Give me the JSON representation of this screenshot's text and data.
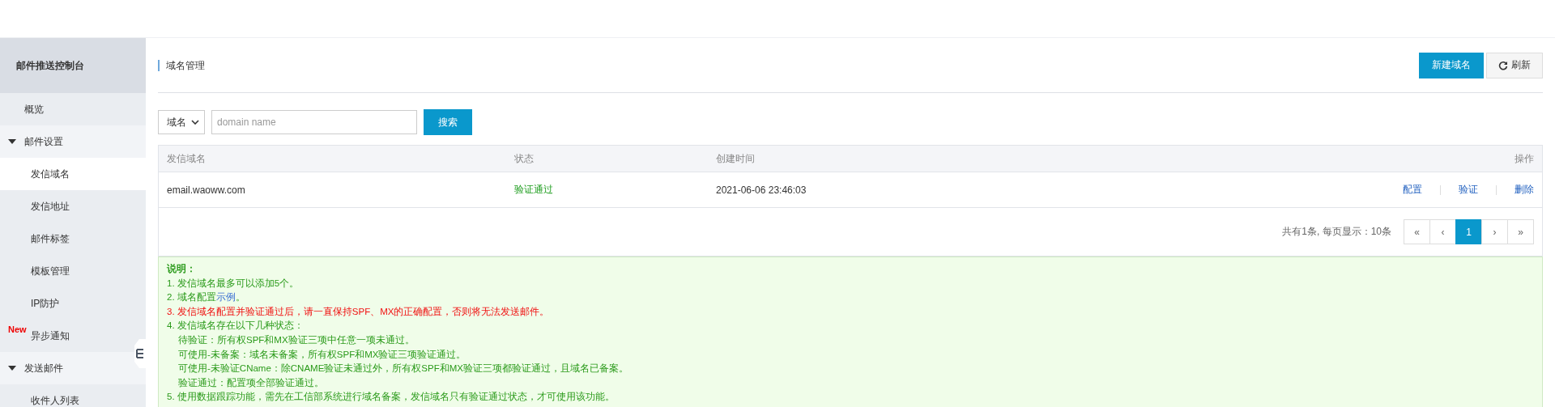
{
  "sidebar": {
    "title": "邮件推送控制台",
    "items": [
      {
        "label": "概览",
        "selected": false
      },
      {
        "label": "邮件设置",
        "expanded": true,
        "selected": false,
        "children": [
          {
            "label": "发信域名",
            "selected": true
          },
          {
            "label": "发信地址",
            "selected": false
          },
          {
            "label": "邮件标签",
            "selected": false
          },
          {
            "label": "模板管理",
            "selected": false
          },
          {
            "label": "IP防护",
            "selected": false
          },
          {
            "label": "异步通知",
            "selected": false,
            "badge": "New"
          }
        ]
      },
      {
        "label": "发送邮件",
        "expanded": true,
        "selected": false,
        "children": [
          {
            "label": "收件人列表",
            "selected": false
          }
        ]
      }
    ]
  },
  "page": {
    "title": "域名管理",
    "buttons": [
      {
        "label": "新建域名",
        "kind": "primary"
      },
      {
        "label": "刷新",
        "kind": "refresh"
      }
    ]
  },
  "search": {
    "filter": "域名",
    "placeholder": "domain name",
    "button": "搜索"
  },
  "table": {
    "columns": [
      "发信域名",
      "状态",
      "创建时间",
      "操作"
    ],
    "rows": [
      {
        "domain": "email.waoww.com",
        "status": "验证通过",
        "created": "2021-06-06 23:46:03",
        "actions": [
          "配置",
          "验证",
          "删除"
        ]
      }
    ]
  },
  "pagination": {
    "summary": "共有1条, 每页显示：10条",
    "controls": [
      {
        "label": "«",
        "selected": false
      },
      {
        "label": "‹",
        "selected": false
      },
      {
        "label": "1",
        "selected": true
      },
      {
        "label": "›",
        "selected": false
      },
      {
        "label": "»",
        "selected": false
      }
    ]
  },
  "notes": {
    "title": "说明：",
    "lines": [
      {
        "kind": "item",
        "text": "1. 发信域名最多可以添加5个。"
      },
      {
        "kind": "link",
        "text": "2. 域名配置",
        "link": "示例",
        "suffix": "。"
      },
      {
        "kind": "warning",
        "text": "3. 发信域名配置并验证通过后，请一直保持SPF、MX的正确配置，否则将无法发送邮件。"
      },
      {
        "kind": "item",
        "text": "4. 发信域名存在以下几种状态："
      },
      {
        "kind": "sub",
        "text": "待验证：所有权SPF和MX验证三项中任意一项未通过。"
      },
      {
        "kind": "sub",
        "text": "可使用-未备案：域名未备案，所有权SPF和MX验证三项验证通过。"
      },
      {
        "kind": "sub",
        "text": "可使用-未验证CName：除CNAME验证未通过外，所有权SPF和MX验证三项都验证通过，且域名已备案。"
      },
      {
        "kind": "sub",
        "text": "验证通过：配置项全部验证通过。"
      },
      {
        "kind": "item",
        "text": "5. 使用数据跟踪功能，需先在工信部系统进行域名备案，发信域名只有验证通过状态，才可使用该功能。"
      }
    ]
  }
}
